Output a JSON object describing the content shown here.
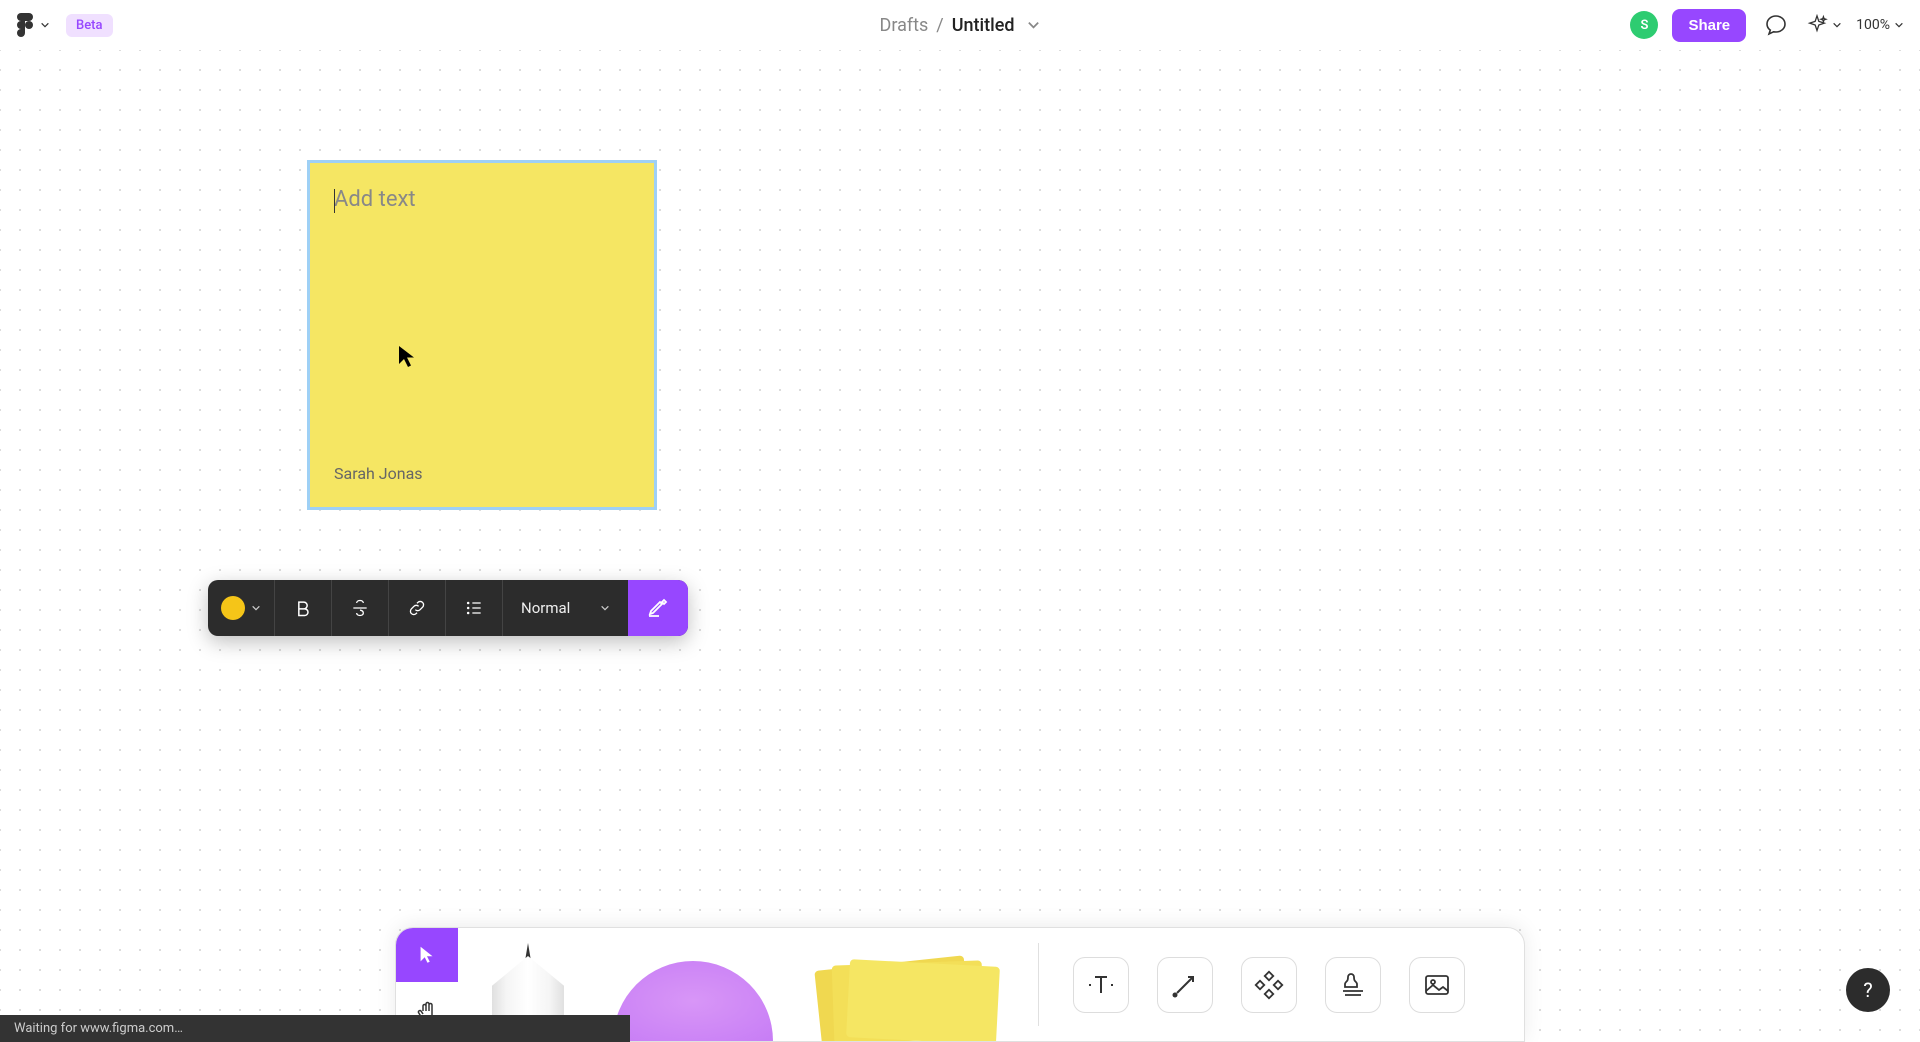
{
  "header": {
    "beta_label": "Beta",
    "breadcrumb_parent": "Drafts",
    "breadcrumb_separator": "/",
    "breadcrumb_current": "Untitled",
    "avatar_letter": "S",
    "share_label": "Share",
    "zoom_level": "100%"
  },
  "sticky_note": {
    "placeholder": "Add text",
    "author": "Sarah Jonas"
  },
  "text_toolbar": {
    "color": "#f5c518",
    "font_weight_label": "Normal"
  },
  "status_bar": {
    "message": "Waiting for www.figma.com…"
  },
  "help": {
    "label": "?"
  }
}
